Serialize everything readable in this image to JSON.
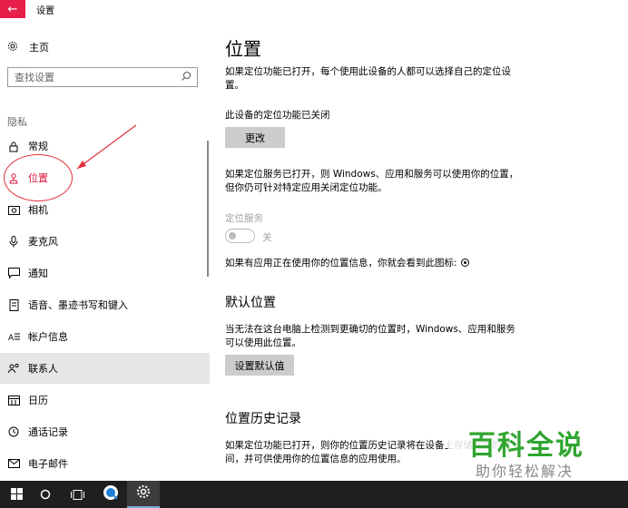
{
  "window": {
    "title": "设置",
    "back_icon": "←"
  },
  "sidebar": {
    "home_label": "主页",
    "search_placeholder": "查找设置",
    "section_label": "隐私",
    "items": [
      {
        "label": "常规",
        "icon": "lock-icon"
      },
      {
        "label": "位置",
        "icon": "location-icon",
        "selected": true
      },
      {
        "label": "相机",
        "icon": "camera-icon"
      },
      {
        "label": "麦克风",
        "icon": "microphone-icon"
      },
      {
        "label": "通知",
        "icon": "notification-icon"
      },
      {
        "label": "语音、墨迹书写和键入",
        "icon": "speech-icon"
      },
      {
        "label": "帐户信息",
        "icon": "account-info-icon"
      },
      {
        "label": "联系人",
        "icon": "contacts-icon"
      },
      {
        "label": "日历",
        "icon": "calendar-icon"
      },
      {
        "label": "通话记录",
        "icon": "call-history-icon"
      },
      {
        "label": "电子邮件",
        "icon": "email-icon"
      }
    ]
  },
  "main": {
    "title": "位置",
    "intro": "如果定位功能已打开，每个使用此设备的人都可以选择自己的定位设置。",
    "device_status": "此设备的定位功能已关闭",
    "change_button": "更改",
    "service_desc": "如果定位服务已打开，则 Windows、应用和服务可以使用你的位置，但你仍可针对特定应用关闭定位功能。",
    "service_label": "定位服务",
    "toggle_state": "关",
    "in_use_text": "如果有应用正在使用你的位置信息，你就会看到此图标:",
    "default_heading": "默认位置",
    "default_desc": "当无法在这台电脑上检测到更确切的位置时，Windows、应用和服务可以使用此位置。",
    "default_button": "设置默认值",
    "history_heading": "位置历史记录",
    "history_desc": "如果定位功能已打开，则你的位置历史记录将在设备上存储有限的时间，并可供使用你的位置信息的应用使用。"
  },
  "watermark": {
    "title": "百科全说",
    "subtitle": "助你轻松解决"
  },
  "taskbar": {
    "items": [
      "windows-start-icon",
      "search-circle-icon",
      "task-view-icon",
      "browser-icon",
      "settings-gear-icon"
    ]
  },
  "colors": {
    "accent": "#e81f4b",
    "selected_text": "#d8163a",
    "watermark_green": "#2fa52f",
    "annotation_red": "#e0303a",
    "taskbar": "#1f1f1f"
  }
}
